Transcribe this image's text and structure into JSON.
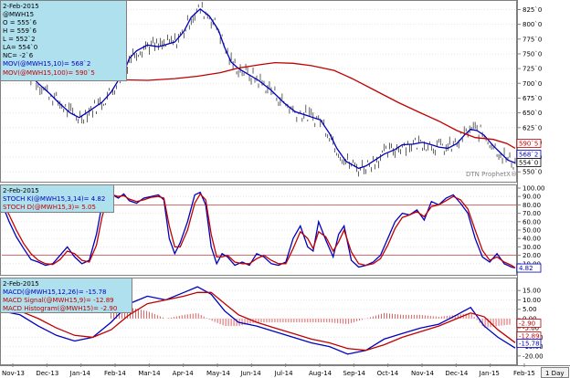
{
  "chart_data": [
    {
      "type": "line",
      "panel": "price",
      "legend": {
        "date": "2-Feb-2015",
        "symbol": "@MWH15",
        "open": "O = 555`6",
        "high": "H = 559`6",
        "low": "L = 552`2",
        "last": "LA= 554`0",
        "net_change": "NC= -2`6",
        "ma10": "MOV(@MWH15,10)= 568`2",
        "ma100": "MOV(@MWH15,100)= 590`5"
      },
      "yticks": [
        "825`0",
        "800`0",
        "775`0",
        "750`0",
        "725`0",
        "700`0",
        "675`0",
        "650`0",
        "625`0",
        "600`0",
        "575`0",
        "550`0"
      ],
      "ylim": [
        538,
        835
      ],
      "value_tags": [
        {
          "text": "590`5",
          "value": 590.5,
          "color": "#c00000"
        },
        {
          "text": "568`2",
          "value": 568.2,
          "color": "#0000c0"
        },
        {
          "text": "554`0",
          "value": 554.0,
          "color": "#000000"
        }
      ],
      "watermark": "DTN ProphetX®",
      "series": [
        {
          "name": "MOV(@MWH15,10)",
          "color": "#0000c0",
          "x": [
            0,
            15,
            28,
            40,
            53,
            62,
            75,
            85,
            95,
            110,
            120,
            128,
            135,
            140,
            148,
            160,
            172,
            190,
            200,
            208,
            218,
            228,
            238,
            245,
            252,
            260,
            270,
            282,
            296,
            310,
            322,
            336,
            350,
            360,
            368,
            378,
            392,
            400,
            410,
            420,
            432,
            440,
            452,
            462,
            472,
            480,
            490,
            500,
            508,
            515,
            522,
            530,
            540,
            548,
            556,
            564
          ],
          "values": [
            745,
            735,
            718,
            700,
            682,
            668,
            650,
            642,
            652,
            668,
            685,
            705,
            722,
            742,
            755,
            765,
            762,
            770,
            788,
            812,
            826,
            814,
            790,
            760,
            736,
            725,
            716,
            705,
            688,
            667,
            652,
            645,
            638,
            615,
            590,
            568,
            556,
            560,
            570,
            580,
            588,
            596,
            597,
            600,
            596,
            592,
            590,
            598,
            612,
            622,
            620,
            612,
            594,
            582,
            570,
            565
          ]
        },
        {
          "name": "MOV(@MWH15,100)",
          "color": "#c00000",
          "x": [
            0,
            30,
            60,
            90,
            110,
            130,
            160,
            190,
            215,
            240,
            260,
            285,
            300,
            320,
            340,
            365,
            385,
            410,
            435,
            460,
            480,
            500,
            520,
            540,
            555,
            564
          ],
          "values": [
            742,
            735,
            725,
            718,
            712,
            706,
            705,
            708,
            712,
            718,
            726,
            732,
            735,
            734,
            730,
            722,
            708,
            688,
            668,
            650,
            636,
            620,
            608,
            605,
            598,
            590
          ]
        }
      ]
    },
    {
      "type": "line",
      "panel": "stochastic",
      "legend": {
        "date": "2-Feb-2015",
        "k": "STOCH K(@MWH15,3,14)= 4.82",
        "d": "STOCH D(@MWH15,3)= 5.05"
      },
      "yticks": [
        "100.00",
        "90.00",
        "80.00",
        "70.00",
        "60.00",
        "50.00",
        "40.00",
        "30.00",
        "20.00",
        "10.00"
      ],
      "ylim": [
        0,
        100
      ],
      "reference_lines": [
        80,
        20
      ],
      "value_tags": [
        {
          "text": "4.82",
          "value": 4.82,
          "color": "#0000c0"
        }
      ],
      "series": [
        {
          "name": "STOCH K(@MWH15,3,14)",
          "color": "#0000c0",
          "x": [
            0,
            8,
            16,
            24,
            32,
            40,
            48,
            56,
            64,
            72,
            80,
            88,
            96,
            104,
            110,
            116,
            122,
            128,
            134,
            140,
            148,
            156,
            164,
            172,
            178,
            184,
            190,
            196,
            204,
            212,
            218,
            224,
            230,
            236,
            242,
            248,
            256,
            264,
            272,
            280,
            288,
            296,
            304,
            312,
            320,
            328,
            336,
            342,
            348,
            356,
            364,
            370,
            376,
            384,
            392,
            400,
            408,
            416,
            424,
            432,
            440,
            448,
            456,
            464,
            472,
            480,
            488,
            496,
            504,
            512,
            520,
            528,
            536,
            544,
            552,
            560,
            564
          ],
          "values": [
            82,
            60,
            42,
            28,
            15,
            12,
            8,
            10,
            20,
            30,
            18,
            10,
            14,
            45,
            80,
            95,
            92,
            88,
            93,
            85,
            82,
            88,
            90,
            92,
            86,
            40,
            22,
            35,
            60,
            92,
            95,
            80,
            30,
            10,
            22,
            18,
            8,
            12,
            8,
            22,
            18,
            10,
            8,
            12,
            40,
            55,
            30,
            25,
            60,
            38,
            18,
            45,
            55,
            14,
            6,
            8,
            12,
            20,
            40,
            60,
            70,
            68,
            74,
            62,
            84,
            80,
            88,
            92,
            82,
            70,
            40,
            18,
            12,
            22,
            10,
            6,
            5
          ]
        },
        {
          "name": "STOCH D(@MWH15,3)",
          "color": "#c00000",
          "x": [
            0,
            8,
            16,
            24,
            32,
            40,
            48,
            56,
            64,
            72,
            80,
            88,
            96,
            104,
            110,
            116,
            122,
            128,
            134,
            140,
            148,
            156,
            164,
            172,
            178,
            184,
            190,
            196,
            204,
            212,
            218,
            224,
            230,
            236,
            242,
            248,
            256,
            264,
            272,
            280,
            288,
            296,
            304,
            312,
            320,
            328,
            336,
            342,
            348,
            356,
            364,
            370,
            376,
            384,
            392,
            400,
            408,
            416,
            424,
            432,
            440,
            448,
            456,
            464,
            472,
            480,
            488,
            496,
            504,
            512,
            520,
            528,
            536,
            544,
            552,
            560,
            564
          ],
          "values": [
            86,
            68,
            50,
            34,
            22,
            14,
            10,
            9,
            15,
            25,
            22,
            14,
            12,
            32,
            65,
            88,
            92,
            90,
            91,
            87,
            84,
            86,
            89,
            90,
            88,
            55,
            30,
            30,
            50,
            82,
            93,
            86,
            45,
            18,
            18,
            20,
            12,
            10,
            10,
            16,
            20,
            14,
            10,
            10,
            28,
            48,
            40,
            28,
            48,
            42,
            25,
            36,
            50,
            24,
            10,
            8,
            10,
            16,
            32,
            52,
            65,
            68,
            72,
            66,
            78,
            80,
            85,
            90,
            86,
            75,
            50,
            26,
            14,
            18,
            12,
            8,
            5
          ]
        }
      ]
    },
    {
      "type": "line",
      "panel": "macd",
      "legend": {
        "date": "2-Feb-2015",
        "macd": "MACD(@MWH15,12,26)= -15.78",
        "signal": "MACD Signal(@MWH15,9)= -12.89",
        "histogram": "MACD Histogram(@MWH15)= -2.90"
      },
      "yticks": [
        "15.00",
        "10.00",
        "5.00",
        "0.00",
        "-5.00",
        "-10.00",
        "-15.00",
        "-20.00"
      ],
      "ylim": [
        -23,
        20
      ],
      "value_tags": [
        {
          "text": "-2.90",
          "value": -2.9,
          "color": "#c00000"
        },
        {
          "text": "-12.89",
          "value": -12.89,
          "color": "#c00000"
        },
        {
          "text": "-15.78",
          "value": -15.78,
          "color": "#0000c0"
        }
      ],
      "series": [
        {
          "name": "MACD(@MWH15,12,26)",
          "color": "#0000c0",
          "x": [
            0,
            20,
            40,
            60,
            80,
            100,
            120,
            140,
            160,
            180,
            200,
            215,
            230,
            245,
            260,
            280,
            300,
            320,
            340,
            360,
            380,
            400,
            420,
            440,
            460,
            480,
            500,
            515,
            530,
            545,
            564
          ],
          "values": [
            4,
            2,
            -4,
            -9,
            -12,
            -10,
            -2,
            8,
            12,
            10,
            14,
            17,
            13,
            4,
            -2,
            -4,
            -7,
            -10,
            -13,
            -15,
            -19,
            -17,
            -11,
            -8,
            -5,
            -3,
            2,
            6,
            -4,
            -10,
            -15.78
          ]
        },
        {
          "name": "MACD Signal(@MWH15,9)",
          "color": "#c00000",
          "x": [
            0,
            20,
            40,
            60,
            80,
            100,
            120,
            140,
            160,
            180,
            200,
            215,
            230,
            245,
            260,
            280,
            300,
            320,
            340,
            360,
            380,
            400,
            420,
            440,
            460,
            480,
            500,
            515,
            530,
            545,
            564
          ],
          "values": [
            6,
            4,
            0,
            -5,
            -9,
            -10,
            -6,
            2,
            8,
            10,
            12,
            14,
            14,
            8,
            2,
            -2,
            -5,
            -8,
            -11,
            -13,
            -16,
            -17,
            -14,
            -10,
            -7,
            -4,
            0,
            3,
            1,
            -6,
            -12.89
          ]
        },
        {
          "name": "MACD Histogram(@MWH15)",
          "color": "#c00000",
          "x": [
            0,
            20,
            40,
            60,
            80,
            100,
            120,
            140,
            160,
            180,
            200,
            215,
            230,
            245,
            260,
            280,
            300,
            320,
            340,
            360,
            380,
            400,
            420,
            440,
            460,
            480,
            500,
            515,
            530,
            545,
            564
          ],
          "values": [
            -2,
            -2,
            -4,
            -4,
            -3,
            0,
            4,
            6,
            4,
            0,
            2,
            3,
            -1,
            -4,
            -4,
            -2,
            -2,
            -2,
            -2,
            -2,
            -3,
            0,
            3,
            2,
            2,
            1,
            2,
            3,
            -5,
            -4,
            -2.9
          ]
        }
      ]
    }
  ],
  "x_axis": {
    "labels": [
      "Nov-13",
      "Dec-13",
      "Jan-14",
      "Feb-14",
      "Mar-14",
      "Apr-14",
      "May-14",
      "Jun-14",
      "Jul-14",
      "Aug-14",
      "Sep-14",
      "Oct-14",
      "Nov-14",
      "Dec-14",
      "Jan-15",
      "Feb-15"
    ],
    "period_button": "1 Day"
  }
}
